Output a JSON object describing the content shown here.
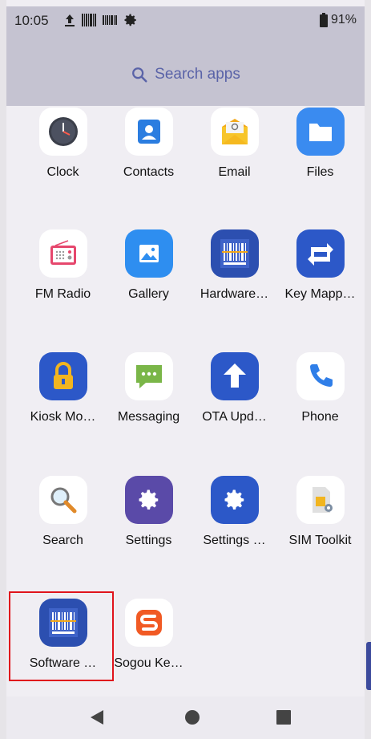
{
  "status_bar": {
    "time": "10:05",
    "battery": "91%"
  },
  "search": {
    "label": "Search apps"
  },
  "apps": [
    {
      "label": "Clock",
      "icon": "clock-icon"
    },
    {
      "label": "Contacts",
      "icon": "contacts-icon"
    },
    {
      "label": "Email",
      "icon": "email-icon"
    },
    {
      "label": "Files",
      "icon": "folder-icon"
    },
    {
      "label": "FM Radio",
      "icon": "radio-icon"
    },
    {
      "label": "Gallery",
      "icon": "gallery-icon"
    },
    {
      "label": "Hardware…",
      "icon": "barcode-icon"
    },
    {
      "label": "Key Mapp…",
      "icon": "swap-arrows-icon"
    },
    {
      "label": "Kiosk Mo…",
      "icon": "lock-icon"
    },
    {
      "label": "Messaging",
      "icon": "message-icon"
    },
    {
      "label": "OTA Upd…",
      "icon": "upload-arrow-icon"
    },
    {
      "label": "Phone",
      "icon": "phone-icon"
    },
    {
      "label": "Search",
      "icon": "magnifier-icon"
    },
    {
      "label": "Settings",
      "icon": "gear-icon"
    },
    {
      "label": "Settings …",
      "icon": "gear-icon"
    },
    {
      "label": "SIM Toolkit",
      "icon": "sim-card-icon"
    },
    {
      "label": "Software …",
      "icon": "barcode-icon"
    },
    {
      "label": "Sogou Ke…",
      "icon": "sogou-s-icon"
    }
  ],
  "colors": {
    "accent": "#5a63a8",
    "selection": "#e0141c",
    "header_bg": "#c5c3d1"
  }
}
